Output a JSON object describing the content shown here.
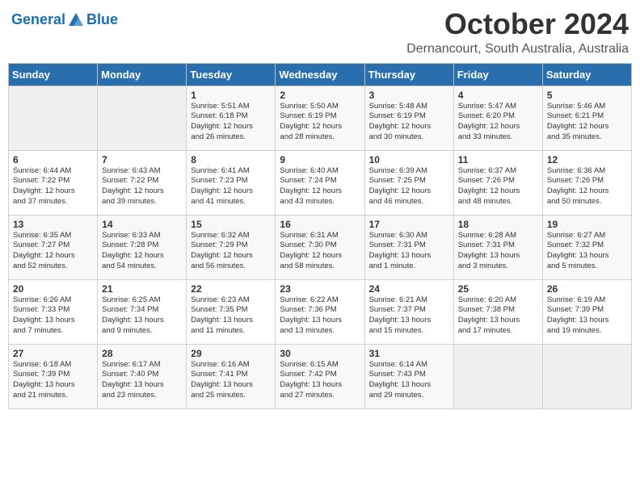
{
  "header": {
    "logo_line1": "General",
    "logo_line2": "Blue",
    "title": "October 2024",
    "subtitle": "Dernancourt, South Australia, Australia"
  },
  "weekdays": [
    "Sunday",
    "Monday",
    "Tuesday",
    "Wednesday",
    "Thursday",
    "Friday",
    "Saturday"
  ],
  "weeks": [
    [
      {
        "day": "",
        "info": ""
      },
      {
        "day": "",
        "info": ""
      },
      {
        "day": "1",
        "info": "Sunrise: 5:51 AM\nSunset: 6:18 PM\nDaylight: 12 hours\nand 26 minutes."
      },
      {
        "day": "2",
        "info": "Sunrise: 5:50 AM\nSunset: 6:19 PM\nDaylight: 12 hours\nand 28 minutes."
      },
      {
        "day": "3",
        "info": "Sunrise: 5:48 AM\nSunset: 6:19 PM\nDaylight: 12 hours\nand 30 minutes."
      },
      {
        "day": "4",
        "info": "Sunrise: 5:47 AM\nSunset: 6:20 PM\nDaylight: 12 hours\nand 33 minutes."
      },
      {
        "day": "5",
        "info": "Sunrise: 5:46 AM\nSunset: 6:21 PM\nDaylight: 12 hours\nand 35 minutes."
      }
    ],
    [
      {
        "day": "6",
        "info": "Sunrise: 6:44 AM\nSunset: 7:22 PM\nDaylight: 12 hours\nand 37 minutes."
      },
      {
        "day": "7",
        "info": "Sunrise: 6:43 AM\nSunset: 7:22 PM\nDaylight: 12 hours\nand 39 minutes."
      },
      {
        "day": "8",
        "info": "Sunrise: 6:41 AM\nSunset: 7:23 PM\nDaylight: 12 hours\nand 41 minutes."
      },
      {
        "day": "9",
        "info": "Sunrise: 6:40 AM\nSunset: 7:24 PM\nDaylight: 12 hours\nand 43 minutes."
      },
      {
        "day": "10",
        "info": "Sunrise: 6:39 AM\nSunset: 7:25 PM\nDaylight: 12 hours\nand 46 minutes."
      },
      {
        "day": "11",
        "info": "Sunrise: 6:37 AM\nSunset: 7:26 PM\nDaylight: 12 hours\nand 48 minutes."
      },
      {
        "day": "12",
        "info": "Sunrise: 6:36 AM\nSunset: 7:26 PM\nDaylight: 12 hours\nand 50 minutes."
      }
    ],
    [
      {
        "day": "13",
        "info": "Sunrise: 6:35 AM\nSunset: 7:27 PM\nDaylight: 12 hours\nand 52 minutes."
      },
      {
        "day": "14",
        "info": "Sunrise: 6:33 AM\nSunset: 7:28 PM\nDaylight: 12 hours\nand 54 minutes."
      },
      {
        "day": "15",
        "info": "Sunrise: 6:32 AM\nSunset: 7:29 PM\nDaylight: 12 hours\nand 56 minutes."
      },
      {
        "day": "16",
        "info": "Sunrise: 6:31 AM\nSunset: 7:30 PM\nDaylight: 12 hours\nand 58 minutes."
      },
      {
        "day": "17",
        "info": "Sunrise: 6:30 AM\nSunset: 7:31 PM\nDaylight: 13 hours\nand 1 minute."
      },
      {
        "day": "18",
        "info": "Sunrise: 6:28 AM\nSunset: 7:31 PM\nDaylight: 13 hours\nand 3 minutes."
      },
      {
        "day": "19",
        "info": "Sunrise: 6:27 AM\nSunset: 7:32 PM\nDaylight: 13 hours\nand 5 minutes."
      }
    ],
    [
      {
        "day": "20",
        "info": "Sunrise: 6:26 AM\nSunset: 7:33 PM\nDaylight: 13 hours\nand 7 minutes."
      },
      {
        "day": "21",
        "info": "Sunrise: 6:25 AM\nSunset: 7:34 PM\nDaylight: 13 hours\nand 9 minutes."
      },
      {
        "day": "22",
        "info": "Sunrise: 6:23 AM\nSunset: 7:35 PM\nDaylight: 13 hours\nand 11 minutes."
      },
      {
        "day": "23",
        "info": "Sunrise: 6:22 AM\nSunset: 7:36 PM\nDaylight: 13 hours\nand 13 minutes."
      },
      {
        "day": "24",
        "info": "Sunrise: 6:21 AM\nSunset: 7:37 PM\nDaylight: 13 hours\nand 15 minutes."
      },
      {
        "day": "25",
        "info": "Sunrise: 6:20 AM\nSunset: 7:38 PM\nDaylight: 13 hours\nand 17 minutes."
      },
      {
        "day": "26",
        "info": "Sunrise: 6:19 AM\nSunset: 7:39 PM\nDaylight: 13 hours\nand 19 minutes."
      }
    ],
    [
      {
        "day": "27",
        "info": "Sunrise: 6:18 AM\nSunset: 7:39 PM\nDaylight: 13 hours\nand 21 minutes."
      },
      {
        "day": "28",
        "info": "Sunrise: 6:17 AM\nSunset: 7:40 PM\nDaylight: 13 hours\nand 23 minutes."
      },
      {
        "day": "29",
        "info": "Sunrise: 6:16 AM\nSunset: 7:41 PM\nDaylight: 13 hours\nand 25 minutes."
      },
      {
        "day": "30",
        "info": "Sunrise: 6:15 AM\nSunset: 7:42 PM\nDaylight: 13 hours\nand 27 minutes."
      },
      {
        "day": "31",
        "info": "Sunrise: 6:14 AM\nSunset: 7:43 PM\nDaylight: 13 hours\nand 29 minutes."
      },
      {
        "day": "",
        "info": ""
      },
      {
        "day": "",
        "info": ""
      }
    ]
  ]
}
